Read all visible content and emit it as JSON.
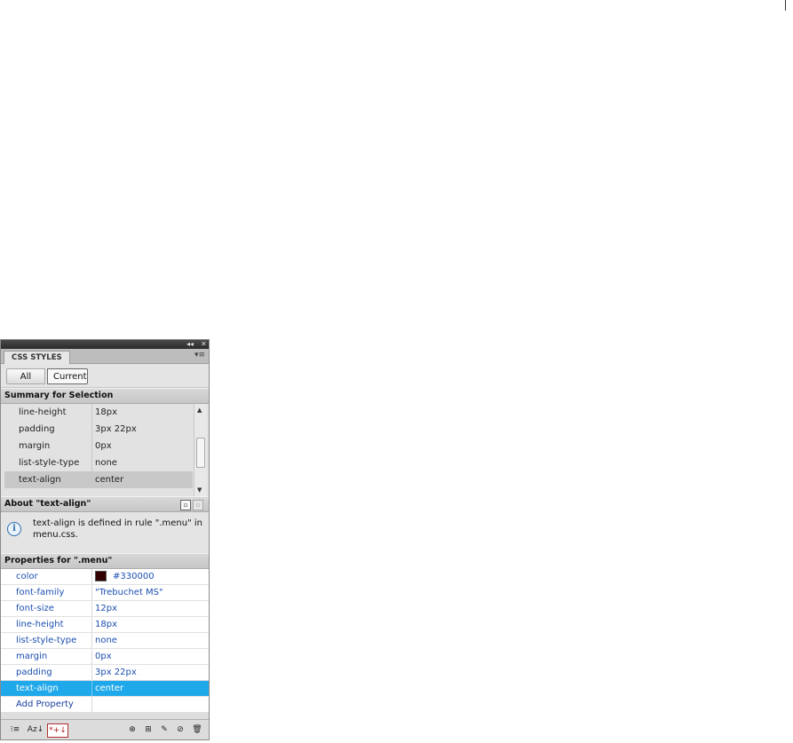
{
  "panel": {
    "title_controls": [
      "◂◂",
      "✕"
    ],
    "tab_label": "CSS STYLES",
    "panel_menu_icon": "menu-icon"
  },
  "modes": {
    "all_label": "All",
    "current_label": "Current",
    "selected": "Current"
  },
  "summary": {
    "heading": "Summary for Selection",
    "rows": [
      {
        "property": "line-height",
        "value": "18px"
      },
      {
        "property": "padding",
        "value": "3px 22px"
      },
      {
        "property": "margin",
        "value": "0px"
      },
      {
        "property": "list-style-type",
        "value": "none"
      },
      {
        "property": "text-align",
        "value": "center"
      }
    ],
    "selected_row": 4
  },
  "about": {
    "heading": "About \"text-align\"",
    "text": "text-align is defined in rule \".menu\" in menu.css."
  },
  "properties": {
    "heading": "Properties for \".menu\"",
    "rows": [
      {
        "property": "color",
        "value": "#330000",
        "swatch": "#330000"
      },
      {
        "property": "font-family",
        "value": "\"Trebuchet MS\""
      },
      {
        "property": "font-size",
        "value": "12px"
      },
      {
        "property": "line-height",
        "value": "18px"
      },
      {
        "property": "list-style-type",
        "value": "none"
      },
      {
        "property": "margin",
        "value": "0px"
      },
      {
        "property": "padding",
        "value": "3px 22px"
      },
      {
        "property": "text-align",
        "value": "center"
      }
    ],
    "selected_row": 7,
    "add_property_label": "Add Property"
  },
  "toolbar": {
    "left_icons": [
      "category-view-icon",
      "alphabetical-view-icon",
      "set-properties-only-icon"
    ],
    "right_icons": [
      "attach-stylesheet-icon",
      "new-css-rule-icon",
      "edit-rule-icon",
      "disable-property-icon",
      "delete-rule-icon"
    ]
  }
}
